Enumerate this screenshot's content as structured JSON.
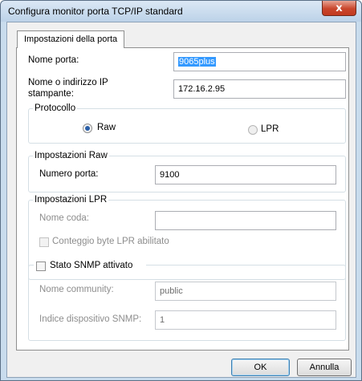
{
  "window": {
    "title": "Configura monitor porta TCP/IP standard",
    "close_glyph": "x"
  },
  "tab": {
    "label": "Impostazioni della porta"
  },
  "port": {
    "name_label": "Nome porta:",
    "name_value": "9065plus",
    "address_label": "Nome o indirizzo IP stampante:",
    "address_value": "172.16.2.95"
  },
  "protocol": {
    "legend": "Protocollo",
    "raw_label": "Raw",
    "lpr_label": "LPR",
    "selected": "Raw"
  },
  "raw_settings": {
    "legend": "Impostazioni Raw",
    "port_number_label": "Numero porta:",
    "port_number_value": "9100"
  },
  "lpr_settings": {
    "legend": "Impostazioni LPR",
    "queue_name_label": "Nome coda:",
    "queue_name_value": "",
    "byte_count_label": "Conteggio byte LPR abilitato",
    "byte_count_checked": false
  },
  "snmp": {
    "status_label": "Stato SNMP attivato",
    "status_checked": false,
    "community_label": "Nome community:",
    "community_value": "public",
    "device_index_label": "Indice dispositivo SNMP:",
    "device_index_value": "1"
  },
  "buttons": {
    "ok": "OK",
    "cancel": "Annulla"
  },
  "colors": {
    "selection": "#3399ff",
    "title_bar": "#bcd2e8",
    "close_button": "#c9462c"
  }
}
